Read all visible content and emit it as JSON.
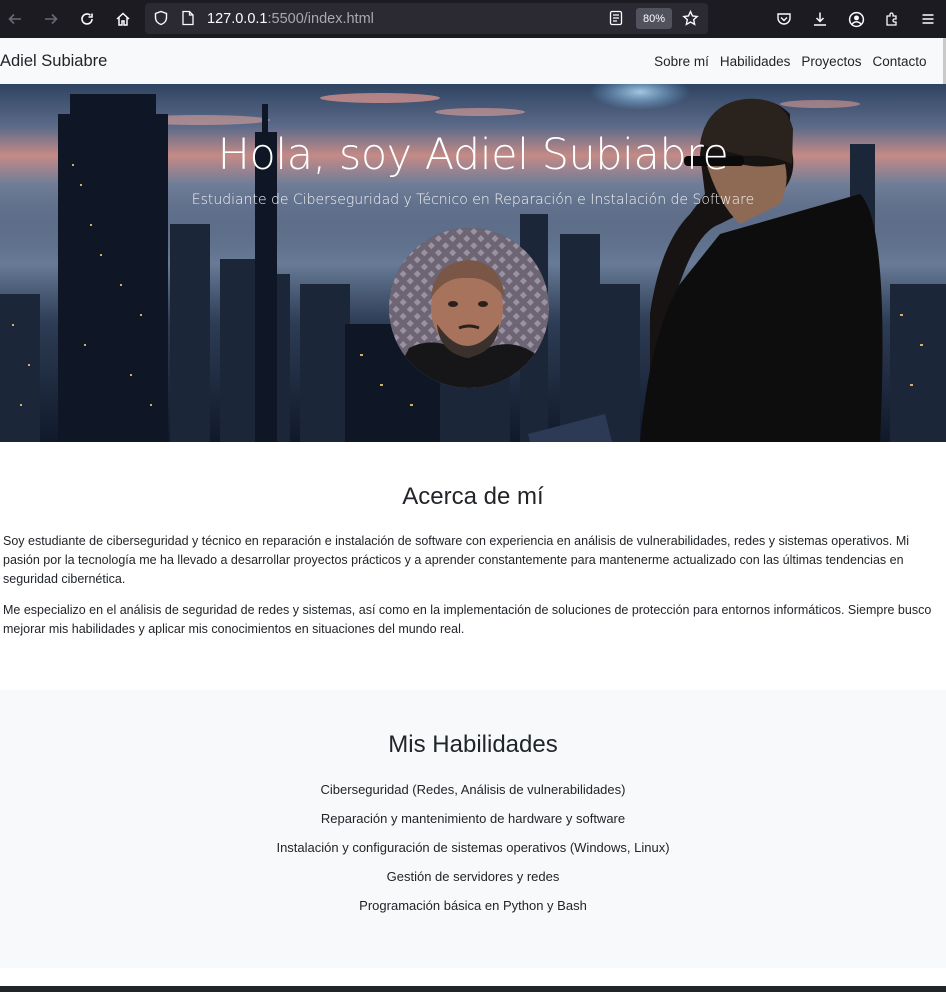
{
  "browser": {
    "url_host": "127.0.0.1",
    "url_rest": ":5500/index.html",
    "zoom": "80%"
  },
  "site": {
    "brand": "Adiel Subiabre",
    "nav": [
      "Sobre mí",
      "Habilidades",
      "Proyectos",
      "Contacto"
    ]
  },
  "hero": {
    "title": "Hola, soy Adiel Subiabre",
    "subtitle": "Estudiante de Ciberseguridad y Técnico en Reparación e Instalación de Software"
  },
  "about": {
    "heading": "Acerca de mí",
    "p1": "Soy estudiante de ciberseguridad y técnico en reparación e instalación de software con experiencia en análisis de vulnerabilidades, redes y sistemas operativos. Mi pasión por la tecnología me ha llevado a desarrollar proyectos prácticos y a aprender constantemente para mantenerme actualizado con las últimas tendencias en seguridad cibernética.",
    "p2": "Me especializo en el análisis de seguridad de redes y sistemas, así como en la implementación de soluciones de protección para entornos informáticos. Siempre busco mejorar mis habilidades y aplicar mis conocimientos en situaciones del mundo real."
  },
  "skills": {
    "heading": "Mis Habilidades",
    "items": [
      "Ciberseguridad (Redes, Análisis de vulnerabilidades)",
      "Reparación y mantenimiento de hardware y software",
      "Instalación y configuración de sistemas operativos (Windows, Linux)",
      "Gestión de servidores y redes",
      "Programación básica en Python y Bash"
    ]
  }
}
